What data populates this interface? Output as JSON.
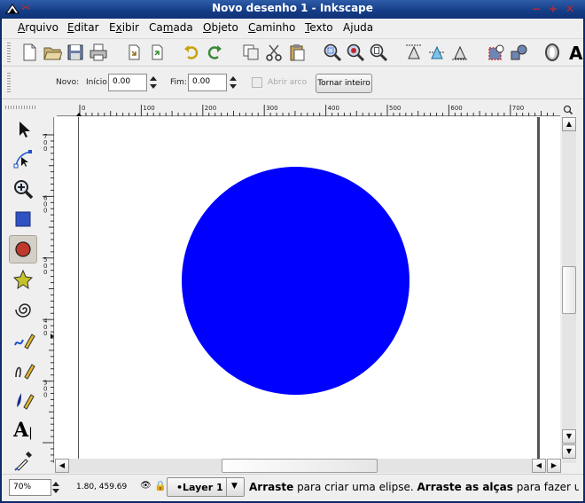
{
  "window": {
    "title": "Novo desenho 1 - Inkscape"
  },
  "menus": [
    "Arquivo",
    "Editar",
    "Exibir",
    "Camada",
    "Objeto",
    "Caminho",
    "Texto",
    "Ajuda"
  ],
  "menu_underline": [
    "A",
    "E",
    "x",
    "m",
    "O",
    "C",
    "T",
    "j"
  ],
  "toolbar_icons": [
    "new-document-icon",
    "open-folder-icon",
    "save-icon",
    "print-icon",
    "import-icon",
    "export-icon",
    "undo-icon",
    "redo-icon",
    "duplicate-icon",
    "cut-icon",
    "paste-icon",
    "zoom-selection-icon",
    "zoom-drawing-icon",
    "zoom-page-icon",
    "align-top-icon",
    "align-center-icon",
    "align-bottom-icon",
    "fill-stroke-icon",
    "xml-editor-icon",
    "preferences-icon"
  ],
  "tool_controls": {
    "new_label": "Novo:",
    "start_label": "Início:",
    "start_value": "0.00",
    "end_label": "Fim:",
    "end_value": "0.00",
    "open_arc_label": "Abrir arco",
    "make_whole_label": "Tornar inteiro"
  },
  "tools": [
    "selector-icon",
    "node-editor-icon",
    "zoom-tool-icon",
    "rectangle-tool-icon",
    "ellipse-tool-icon",
    "star-tool-icon",
    "spiral-tool-icon",
    "pencil-tool-icon",
    "pen-tool-icon",
    "calligraphy-tool-icon",
    "text-tool-icon",
    "dropper-tool-icon"
  ],
  "active_tool": "ellipse-tool-icon",
  "ruler": {
    "h_ticks": [
      "0",
      "100",
      "200",
      "300",
      "400",
      "500",
      "600",
      "700"
    ],
    "v_ticks": [
      "700",
      "600",
      "500",
      "400",
      "300"
    ]
  },
  "canvas": {
    "ellipse_fill": "#0000ff",
    "page_color": "#ffffff"
  },
  "status": {
    "zoom": "70%",
    "coords": "1.80, 459.69",
    "layer": "•Layer 1",
    "msg_b1": "Arraste",
    "msg_t1": " para criar uma elipse. ",
    "msg_b2": "Arraste as alças",
    "msg_t2": " para fazer um a"
  },
  "colors": {
    "title_bar": "#1c4590",
    "accent_red": "#c0292b"
  }
}
